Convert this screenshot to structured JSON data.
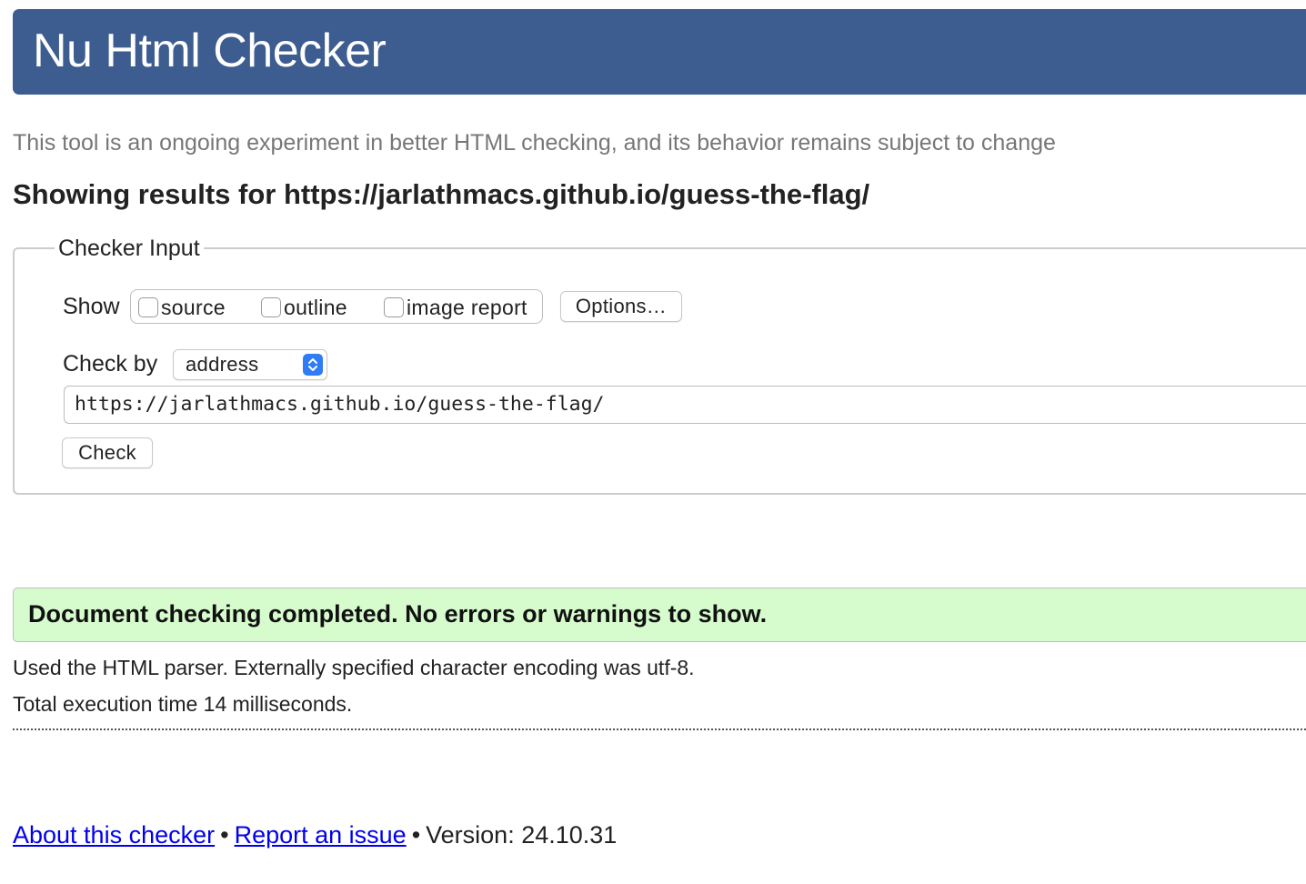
{
  "header": {
    "title": "Nu Html Checker",
    "background_color": "#3d5c8f"
  },
  "tagline": "This tool is an ongoing experiment in better HTML checking, and its behavior remains subject to change",
  "results_heading": {
    "prefix": "Showing results for ",
    "url": "https://jarlathmacs.github.io/guess-the-flag/"
  },
  "checker_input": {
    "legend": "Checker Input",
    "show_label": "Show",
    "show_options": [
      {
        "label": "source",
        "checked": false
      },
      {
        "label": "outline",
        "checked": false
      },
      {
        "label": "image report",
        "checked": false
      }
    ],
    "options_button": "Options…",
    "check_by_label": "Check by",
    "check_by_selected": "address",
    "url_value": "https://jarlathmacs.github.io/guess-the-flag/",
    "check_button": "Check"
  },
  "result": {
    "message": "Document checking completed. No errors or warnings to show.",
    "background_color": "#d6fbcd"
  },
  "details": {
    "parser_line": "Used the HTML parser. Externally specified character encoding was utf-8.",
    "time_line": "Total execution time 14 milliseconds."
  },
  "footer": {
    "about_link": "About this checker",
    "separator": "•",
    "report_link": "Report an issue",
    "version": "Version: 24.10.31"
  }
}
